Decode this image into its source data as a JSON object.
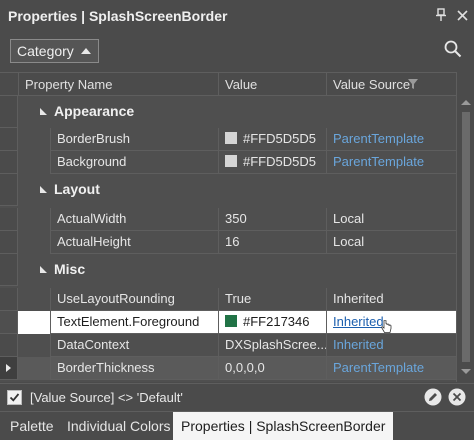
{
  "window": {
    "title": "Properties | SplashScreenBorder",
    "icons": [
      "pin-icon",
      "close-icon"
    ]
  },
  "toolbar": {
    "category_label": "Category",
    "search_icon": "search-icon"
  },
  "grid": {
    "columns": [
      "Property Name",
      "Value",
      "Value Source"
    ],
    "categories": [
      {
        "label": "Appearance",
        "rows": [
          {
            "name": "BorderBrush",
            "value": "#FFD5D5D5",
            "swatch": "#FFD5D5D5",
            "source": "ParentTemplate",
            "source_link": true
          },
          {
            "name": "Background",
            "value": "#FFD5D5D5",
            "swatch": "#FFD5D5D5",
            "source": "ParentTemplate",
            "source_link": true
          }
        ]
      },
      {
        "label": "Layout",
        "rows": [
          {
            "name": "ActualWidth",
            "value": "350",
            "source": "Local",
            "source_link": false
          },
          {
            "name": "ActualHeight",
            "value": "16",
            "source": "Local",
            "source_link": false
          }
        ]
      },
      {
        "label": "Misc",
        "rows": [
          {
            "name": "UseLayoutRounding",
            "value": "True",
            "source": "Inherited",
            "source_link": false
          },
          {
            "name": "TextElement.Foreground",
            "value": "#FF217346",
            "swatch": "#217346",
            "source": "Inherited",
            "source_link": true,
            "selected": true
          },
          {
            "name": "DataContext",
            "value": "DXSplashScree...",
            "source": "Inherited",
            "source_link": true
          },
          {
            "name": "BorderThickness",
            "value": "0,0,0,0",
            "source": "ParentTemplate",
            "source_link": true,
            "current": true
          }
        ]
      }
    ]
  },
  "filterbar": {
    "checked": true,
    "text": "[Value Source] <> 'Default'"
  },
  "tabs": [
    {
      "label": "Palette",
      "active": false
    },
    {
      "label": "Individual Colors",
      "active": false
    },
    {
      "label": "Properties | SplashScreenBorder",
      "active": true
    }
  ]
}
